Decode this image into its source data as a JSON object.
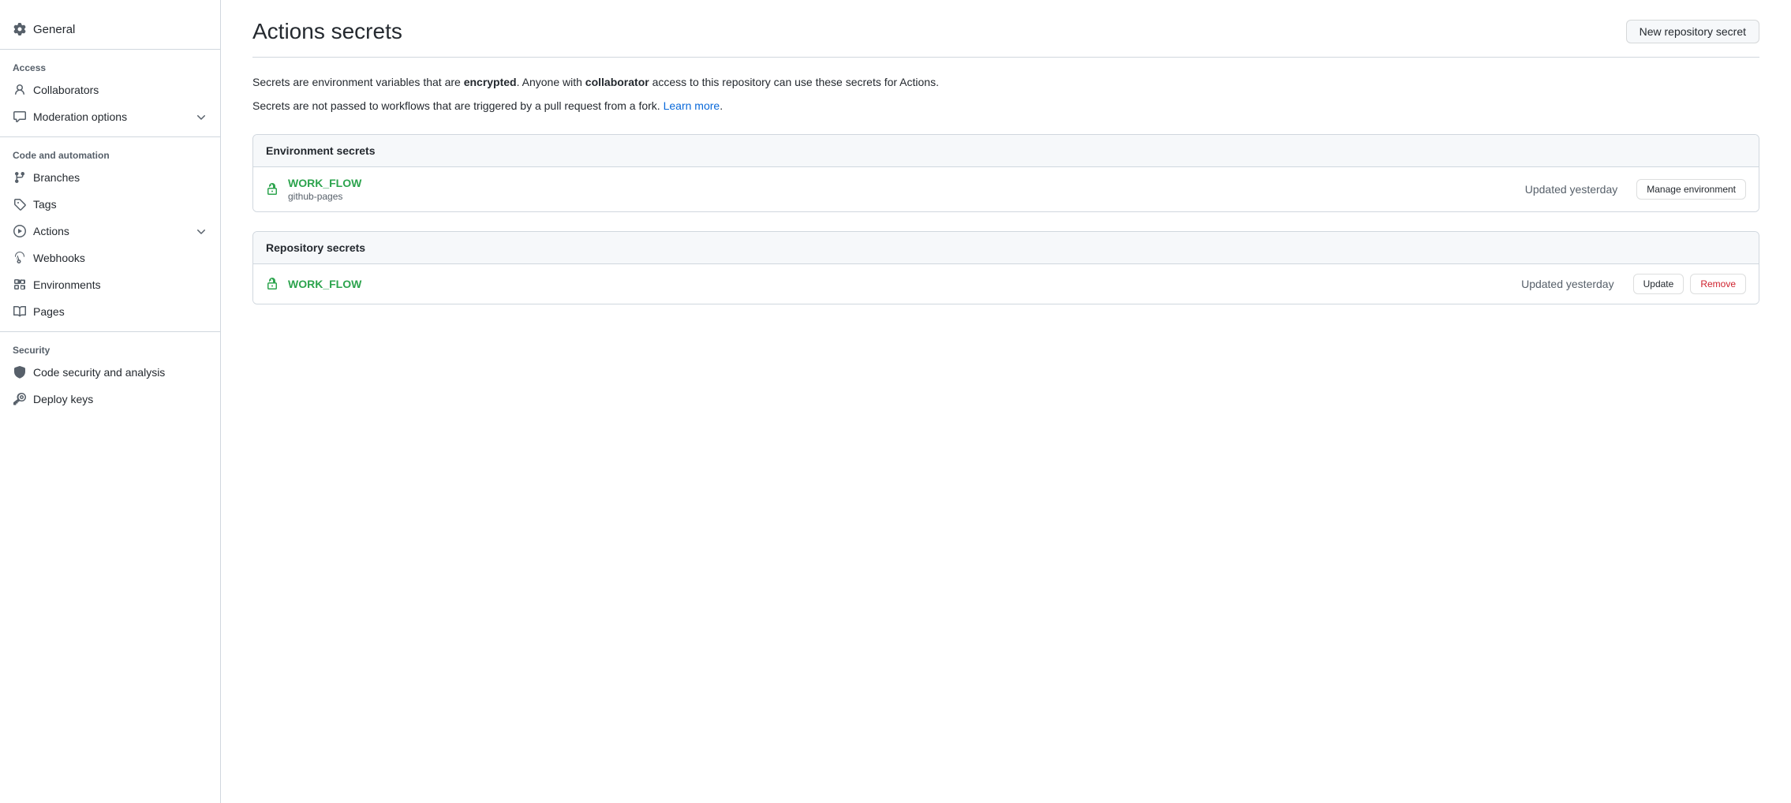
{
  "sidebar": {
    "general_label": "General",
    "sections": [
      {
        "id": "access",
        "label": "Access",
        "items": [
          {
            "id": "collaborators",
            "label": "Collaborators",
            "icon": "person",
            "has_chevron": false
          },
          {
            "id": "moderation",
            "label": "Moderation options",
            "icon": "comment",
            "has_chevron": true
          }
        ]
      },
      {
        "id": "code-automation",
        "label": "Code and automation",
        "items": [
          {
            "id": "branches",
            "label": "Branches",
            "icon": "branch",
            "has_chevron": false
          },
          {
            "id": "tags",
            "label": "Tags",
            "icon": "tag",
            "has_chevron": false
          },
          {
            "id": "actions",
            "label": "Actions",
            "icon": "play",
            "has_chevron": true
          },
          {
            "id": "webhooks",
            "label": "Webhooks",
            "icon": "webhook",
            "has_chevron": false
          },
          {
            "id": "environments",
            "label": "Environments",
            "icon": "grid",
            "has_chevron": false
          },
          {
            "id": "pages",
            "label": "Pages",
            "icon": "pages",
            "has_chevron": false
          }
        ]
      },
      {
        "id": "security",
        "label": "Security",
        "items": [
          {
            "id": "code-security",
            "label": "Code security and analysis",
            "icon": "shield",
            "has_chevron": false
          },
          {
            "id": "deploy-keys",
            "label": "Deploy keys",
            "icon": "key",
            "has_chevron": false
          }
        ]
      }
    ]
  },
  "main": {
    "title": "Actions secrets",
    "new_secret_button": "New repository secret",
    "description_part1": "Secrets are environment variables that are ",
    "description_bold1": "encrypted",
    "description_part2": ". Anyone with ",
    "description_bold2": "collaborator",
    "description_part3": " access to this repository can use these secrets for Actions.",
    "description_sub_text": "Secrets are not passed to workflows that are triggered by a pull request from a fork. ",
    "learn_more_label": "Learn more",
    "environment_secrets": {
      "header": "Environment secrets",
      "items": [
        {
          "name": "WORK_FLOW",
          "env": "github-pages",
          "updated": "Updated yesterday",
          "action_label": "Manage environment"
        }
      ]
    },
    "repository_secrets": {
      "header": "Repository secrets",
      "items": [
        {
          "name": "WORK_FLOW",
          "updated": "Updated yesterday",
          "update_label": "Update",
          "remove_label": "Remove"
        }
      ]
    }
  },
  "colors": {
    "green": "#2da44e",
    "link": "#0969da",
    "danger": "#cf222e"
  }
}
